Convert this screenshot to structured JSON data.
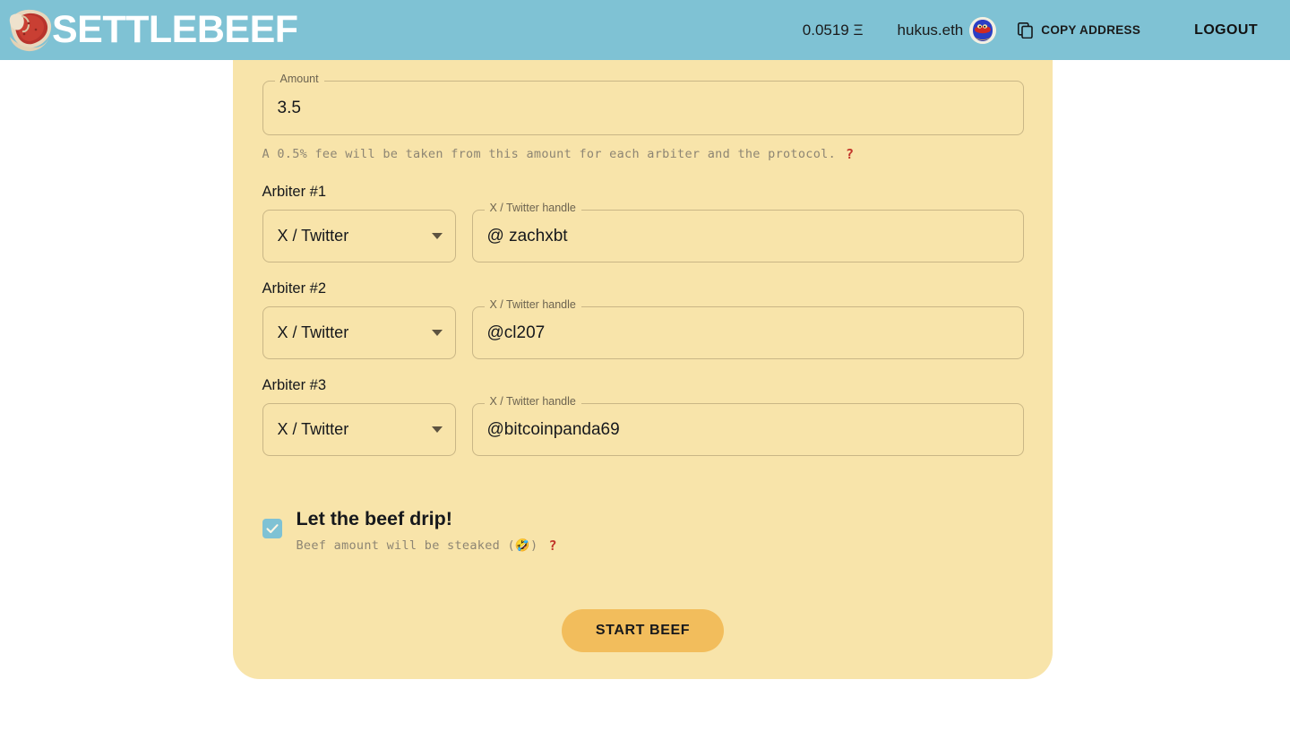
{
  "header": {
    "brand_name": "SETTLEBEEF",
    "logo_icon": "steak-icon",
    "balance": "0.0519 Ξ",
    "account_name": "hukus.eth",
    "avatar_icon": "avatar-blue-character",
    "copy_icon": "copy-icon",
    "copy_label": "COPY ADDRESS",
    "logout_label": "LOGOUT",
    "bg_color": "#7fc2d4"
  },
  "card": {
    "bg_color": "#f8e4aa",
    "border_color": "#c9b686"
  },
  "form": {
    "amount": {
      "legend": "Amount",
      "value": "3.5",
      "placeholder": "Amount"
    },
    "fee_note": {
      "text": "A 0.5% fee will be taken from this amount for each arbiter and the protocol.",
      "help_glyph": "?",
      "help_color": "#c2362b"
    },
    "arbiters": [
      {
        "label": "Arbiter #1",
        "platform": "X / Twitter",
        "handle_legend": "X / Twitter handle",
        "handle": "@ zachxbt",
        "placeholder": "X / Twitter handle"
      },
      {
        "label": "Arbiter #2",
        "platform": "X / Twitter",
        "handle_legend": "X / Twitter handle",
        "handle": "@cl207",
        "placeholder": "X / Twitter handle"
      },
      {
        "label": "Arbiter #3",
        "platform": "X / Twitter",
        "handle_legend": "X / Twitter handle",
        "handle": "@bitcoinpanda69",
        "placeholder": "X / Twitter handle"
      }
    ],
    "drip": {
      "checked": true,
      "checkbox_color": "#7fc2d4",
      "title": "Let the beef drip!",
      "subtitle": "Beef amount will be steaked (🤣)",
      "help_glyph": "?"
    },
    "submit": {
      "label": "START BEEF",
      "bg_color": "#f2bd5c"
    }
  }
}
